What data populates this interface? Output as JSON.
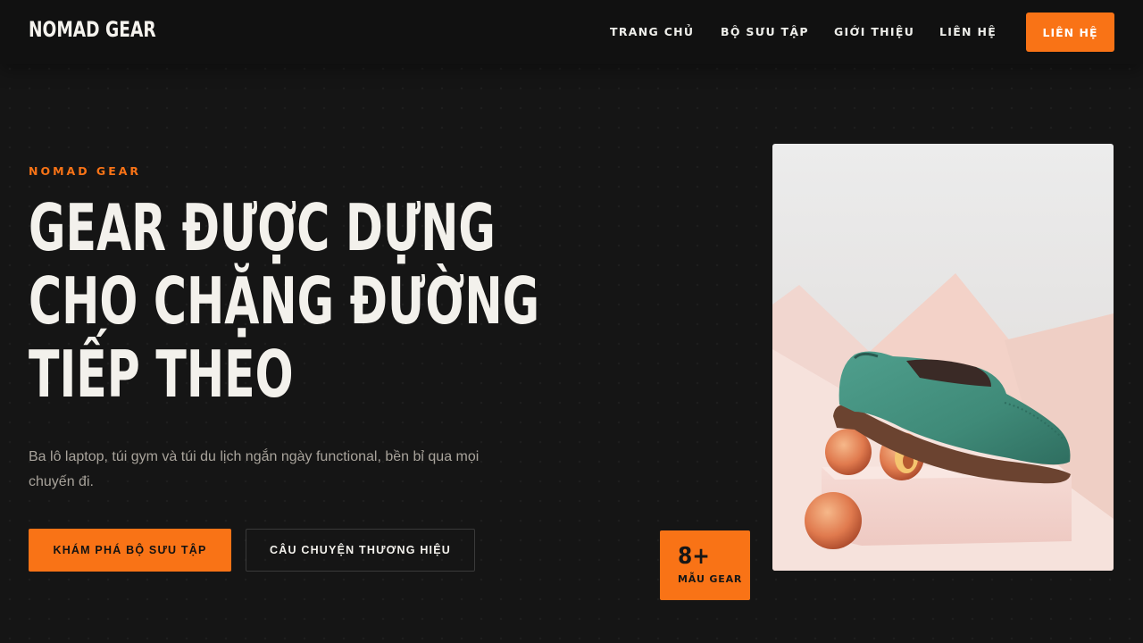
{
  "header": {
    "logo": "NOMAD GEAR",
    "nav": [
      "TRANG CHỦ",
      "BỘ SƯU TẬP",
      "GIỚI THIỆU",
      "LIÊN HỆ"
    ],
    "cta_label": "LIÊN HỆ"
  },
  "hero": {
    "eyebrow": "NOMAD GEAR",
    "headline_lines": [
      "GEAR ĐƯỢC DỰNG",
      "CHO CHẶNG ĐƯỜNG",
      "TIẾP THEO"
    ],
    "subtitle": "Ba lô laptop, túi gym và túi du lịch ngắn ngày functional, bền bỉ qua mọi chuyến đi.",
    "primary_button": "KHÁM PHÁ BỘ SƯU TẬP",
    "secondary_button": "CÂU CHUYỆN THƯƠNG HIỆU",
    "badge": {
      "number": "8+",
      "label": "MẪU GEAR"
    },
    "image": {
      "subject": "green suede shoe on peaches and pink block"
    }
  },
  "colors": {
    "accent": "#f97316",
    "background": "#151515",
    "header": "#111111",
    "text": "#f3f1ec",
    "muted": "#a8a39b"
  }
}
